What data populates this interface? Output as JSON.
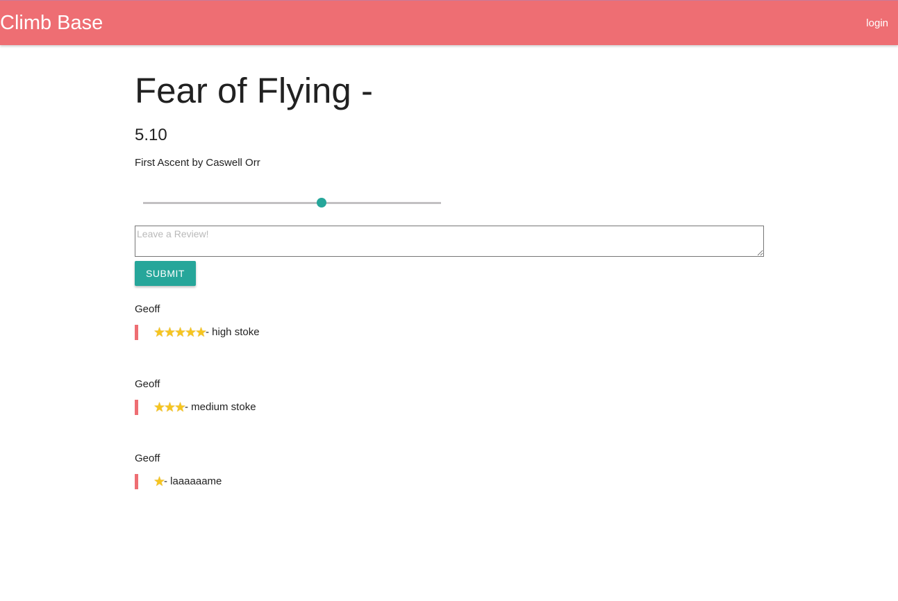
{
  "navbar": {
    "brand": "Climb Base",
    "login": "login"
  },
  "climb": {
    "title": "Fear of Flying -",
    "grade": "5.10",
    "first_ascent_label": "First Ascent by",
    "first_ascent_name": "Caswell Orr"
  },
  "rating_slider": {
    "value_fraction": 0.6
  },
  "review_form": {
    "placeholder": "Leave a Review!",
    "value": "",
    "submit_label": "SUBMIT"
  },
  "reviews": [
    {
      "author": "Geoff",
      "stars": 5,
      "star_icon": "star-icon",
      "text": "- high stoke"
    },
    {
      "author": "Geoff",
      "stars": 3,
      "star_icon": "star-icon",
      "text": "- medium stoke"
    },
    {
      "author": "Geoff",
      "stars": 1,
      "star_icon": "star-icon",
      "text": "- laaaaaame"
    }
  ],
  "colors": {
    "navbar": "#ee6e73",
    "accent": "#26a69a",
    "quote_border": "#ee6e73",
    "star": "#f6c51f"
  }
}
